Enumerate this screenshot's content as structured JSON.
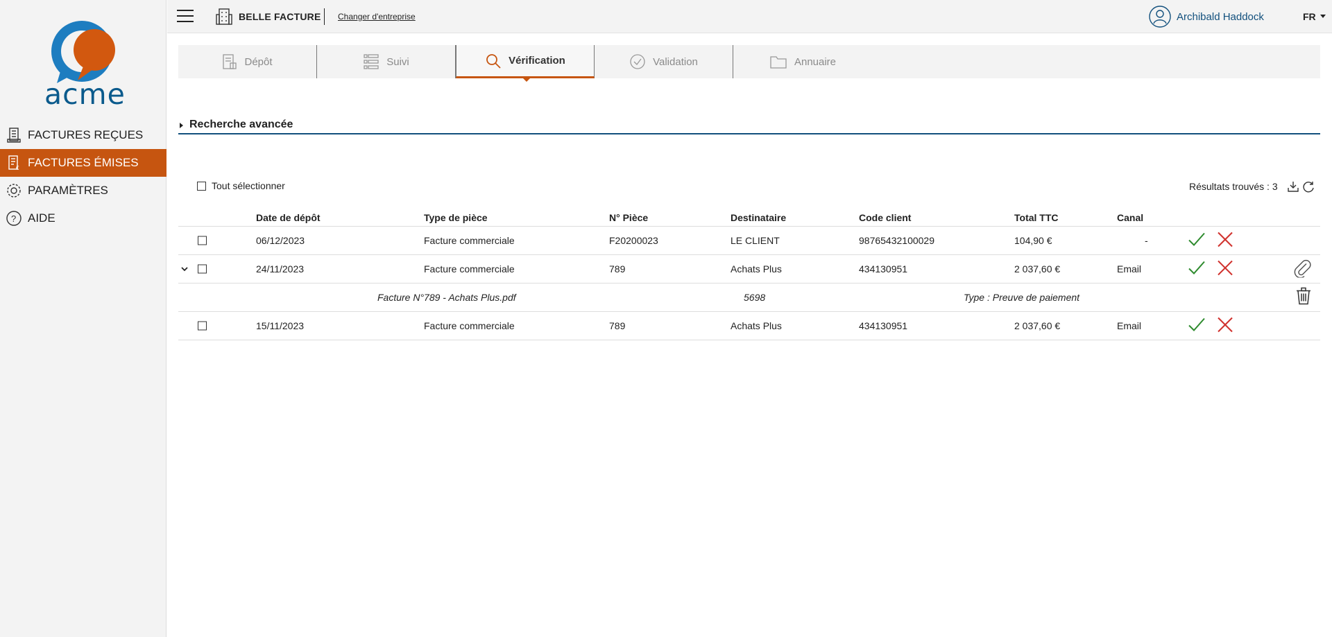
{
  "sidebar": {
    "logo_text": "acme",
    "items": [
      {
        "label": "FACTURES REÇUES",
        "icon": "received-invoices-icon"
      },
      {
        "label": "FACTURES ÉMISES",
        "icon": "issued-invoices-icon",
        "active": true
      },
      {
        "label": "PARAMÈTRES",
        "icon": "gear-icon"
      },
      {
        "label": "AIDE",
        "icon": "help-icon"
      }
    ]
  },
  "topbar": {
    "company_name": "BELLE FACTURE",
    "change_company": "Changer d'entreprise",
    "user_name": "Archibald Haddock",
    "language": "FR"
  },
  "tabs": [
    {
      "label": "Dépôt",
      "icon": "document-icon"
    },
    {
      "label": "Suivi",
      "icon": "list-icon"
    },
    {
      "label": "Vérification",
      "icon": "search-icon",
      "active": true
    },
    {
      "label": "Validation",
      "icon": "check-circle-icon"
    },
    {
      "label": "Annuaire",
      "icon": "folder-icon"
    }
  ],
  "advanced_search": "Recherche avancée",
  "select_all": "Tout sélectionner",
  "results_label": "Résultats trouvés : 3",
  "table": {
    "headers": {
      "date": "Date de dépôt",
      "type": "Type de pièce",
      "num": "N° Pièce",
      "dest": "Destinataire",
      "code": "Code client",
      "total": "Total TTC",
      "canal": "Canal"
    },
    "rows": [
      {
        "date": "06/12/2023",
        "type": "Facture commerciale",
        "num": "F20200023",
        "dest": "LE CLIENT",
        "code": "98765432100029",
        "total": "104,90 €",
        "canal": "-"
      },
      {
        "date": "24/11/2023",
        "type": "Facture commerciale",
        "num": "789",
        "dest": "Achats Plus",
        "code": "434130951",
        "total": "2 037,60 €",
        "canal": "Email"
      },
      {
        "date": "15/11/2023",
        "type": "Facture commerciale",
        "num": "789",
        "dest": "Achats Plus",
        "code": "434130951",
        "total": "2 037,60 €",
        "canal": "Email"
      }
    ],
    "attachment": {
      "file": "Facture N°789 - Achats Plus.pdf",
      "num": "5698",
      "type": "Type : Preuve de paiement"
    }
  },
  "colors": {
    "accent": "#c65510",
    "brand_blue": "#12507d",
    "ok_green": "#2e8b2e",
    "ko_red": "#d0312d"
  }
}
